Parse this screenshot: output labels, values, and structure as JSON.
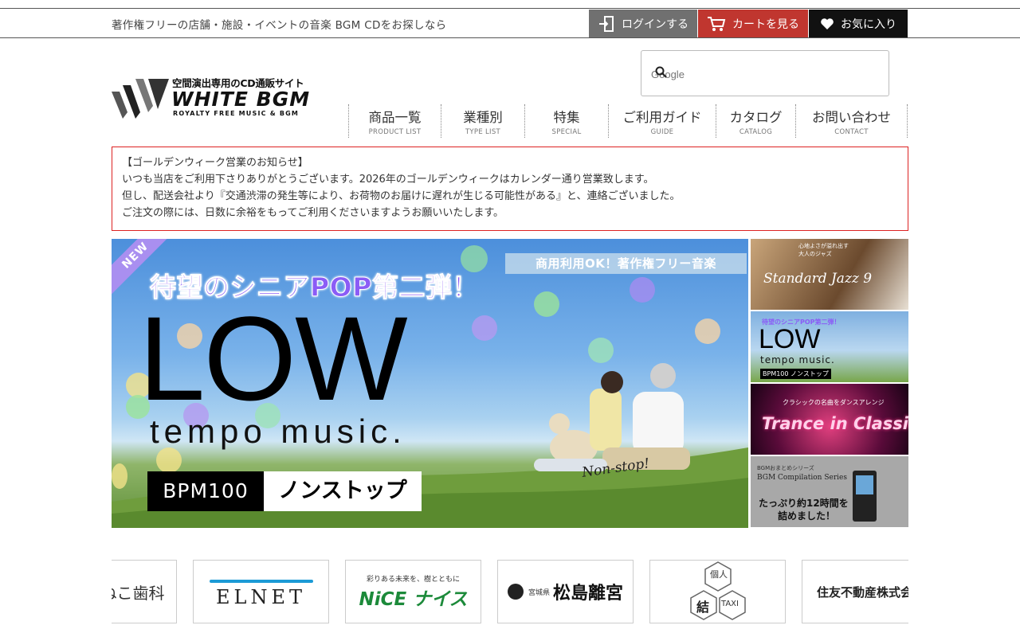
{
  "topbar": {
    "tagline": "著作権フリーの店舗・施設・イベントの音楽 BGM CDをお探しなら",
    "login_label": "ログインする",
    "cart_label": "カートを見る",
    "favorites_label": "お気に入り",
    "colors": {
      "login": "#707070",
      "cart": "#c0362f",
      "favorites": "#111111"
    }
  },
  "logo": {
    "tagline": "空間演出専用のCD通販サイト",
    "name": "WHITE BGM",
    "sub": "ROYALTY FREE MUSIC & BGM"
  },
  "search": {
    "placeholder": "Google"
  },
  "nav": [
    {
      "label": "商品一覧",
      "sub": "PRODUCT LIST"
    },
    {
      "label": "業種別",
      "sub": "TYPE LIST"
    },
    {
      "label": "特集",
      "sub": "SPECIAL"
    },
    {
      "label": "ご利用ガイド",
      "sub": "GUIDE"
    },
    {
      "label": "カタログ",
      "sub": "CATALOG"
    },
    {
      "label": "お問い合わせ",
      "sub": "CONTACT"
    }
  ],
  "notice": {
    "title": "【ゴールデンウィーク営業のお知らせ】",
    "lines": [
      "いつも当店をご利用下さりありがとうございます。2026年のゴールデンウィークはカレンダー通り営業致します。",
      "但し、配送会社より『交通渋滞の発生等により、お荷物のお届けに遅れが生じる可能性がある』と、連絡ございました。",
      "ご注文の際には、日数に余裕をもってご利用くださいますようお願いいたします。"
    ],
    "border_color": "#dd2222"
  },
  "banner": {
    "ribbon": "NEW",
    "caption": "商用利用OK！著作権フリー音楽",
    "headline": "待望のシニアPOP第二弾！",
    "big_text": "LOW",
    "sub_text": "tempo music.",
    "bpm": "BPM100",
    "nonstop_jp": "ノンストップ",
    "nonstop_en": "Non-stop!"
  },
  "thumbnails": [
    {
      "title": "Standard Jazz 9",
      "lines": [
        "心地よさが溢れ出す",
        "大人のジャズ"
      ]
    },
    {
      "title": "LOW",
      "lines": [
        "待望のシニアPOP第二弾！",
        "tempo music.",
        "BPM100 ノンストップ"
      ]
    },
    {
      "title": "Trance in Classics",
      "lines": [
        "クラシックの名曲をダンスアレンジ"
      ]
    },
    {
      "title": "BGM Compilation Series",
      "lines": [
        "BGMおまとめシリーズ",
        "たっぷり約12時間を",
        "詰めました！"
      ]
    }
  ],
  "clients": [
    {
      "name": "ねこ歯科"
    },
    {
      "name": "ELNET"
    },
    {
      "tagline": "彩りある未来を、樹とともに",
      "name": "NiCE ナイス"
    },
    {
      "prefix": "宮城県",
      "name": "松島離宮"
    },
    {
      "name": "結",
      "tag1": "個人",
      "tag2": "TAXI"
    },
    {
      "name": "住友不動産株式会"
    }
  ]
}
